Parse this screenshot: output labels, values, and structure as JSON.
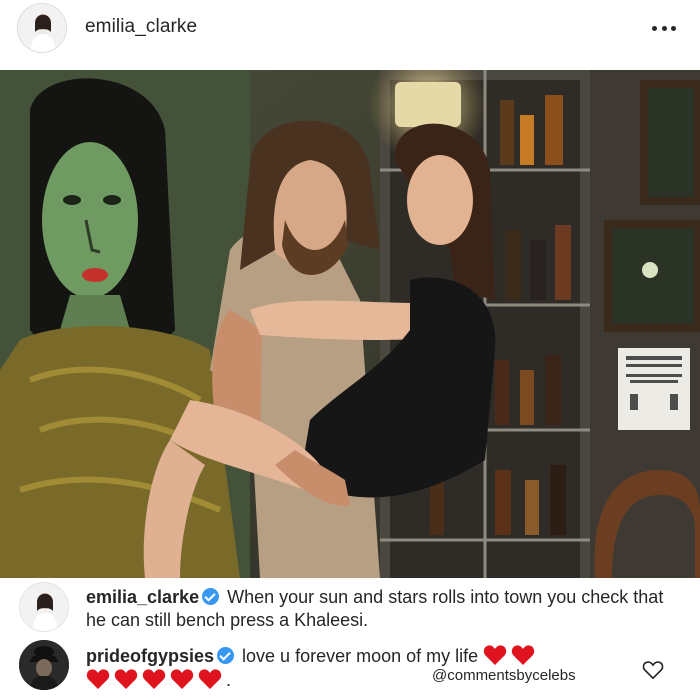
{
  "header": {
    "username": "emilia_clarke"
  },
  "comments": [
    {
      "username": "emilia_clarke",
      "verified": true,
      "text": " When your sun and stars rolls into town you check that he can still bench press a Khaleesi."
    },
    {
      "username": "prideofgypsies",
      "verified": true,
      "text_line1": " love u forever moon of my life ",
      "heart_count_line1": 2,
      "heart_count_line2": 5,
      "line2_suffix": ".",
      "credit": "@commentsbycelebs"
    }
  ],
  "icons": {
    "more": "more-options-icon",
    "verified": "verified-badge-icon",
    "heart": "red-heart-emoji",
    "like": "heart-outline-icon"
  },
  "colors": {
    "verified_blue": "#3897f0",
    "heart_red": "#e0141e",
    "text": "#262626"
  }
}
